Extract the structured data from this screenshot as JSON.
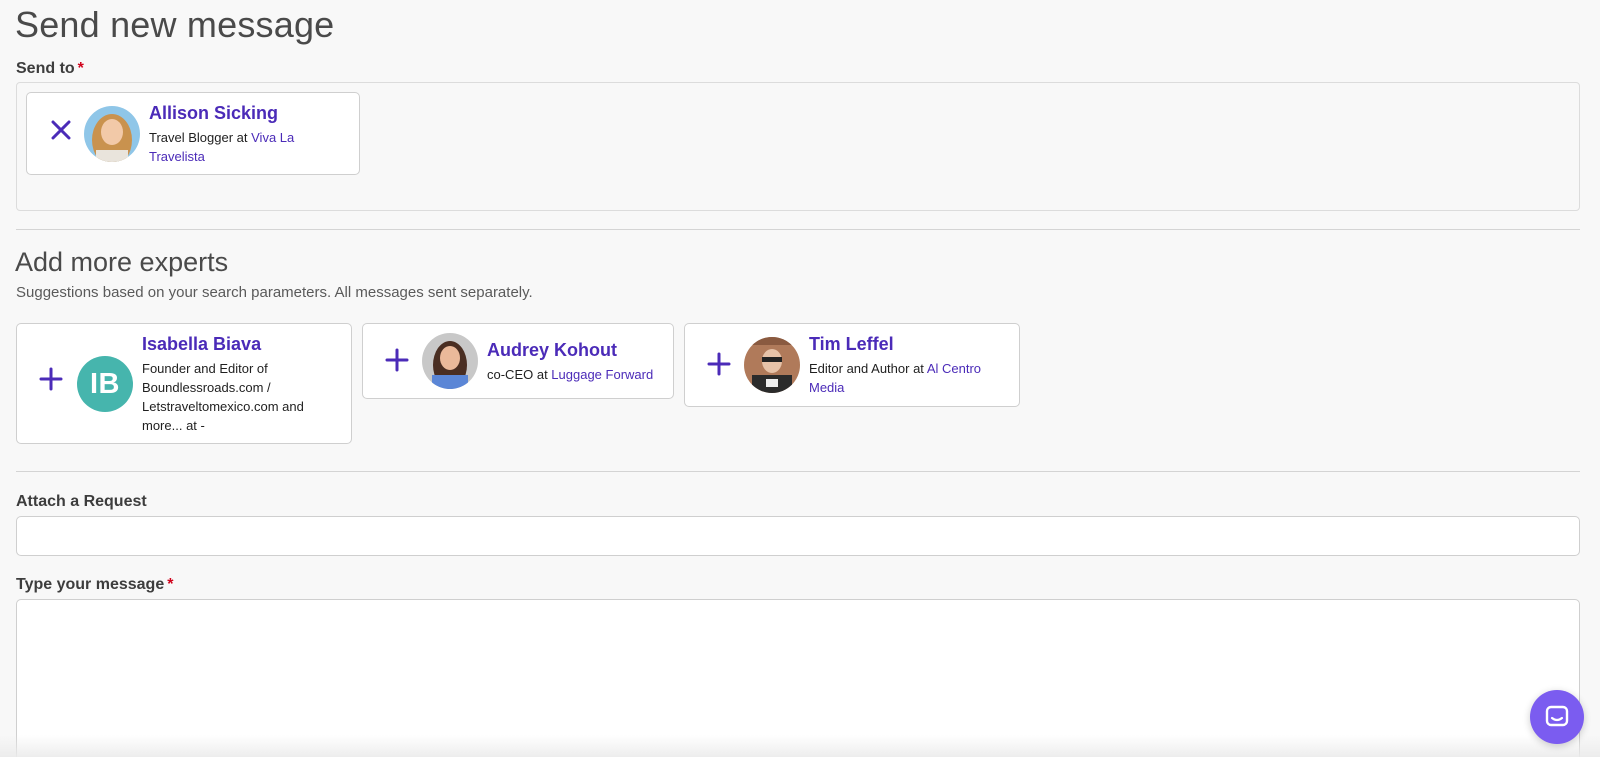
{
  "page": {
    "title": "Send new message"
  },
  "send_to": {
    "label": "Send to",
    "required_mark": "*",
    "recipients": [
      {
        "name": "Allison Sicking",
        "role": "Travel Blogger at ",
        "org": "Viva La Travelista",
        "action_icon": "close-icon"
      }
    ]
  },
  "experts": {
    "title": "Add more experts",
    "subtitle": "Suggestions based on your search parameters. All messages sent separately.",
    "items": [
      {
        "name": "Isabella Biava",
        "initials": "IB",
        "role": "Founder and Editor of Boundlessroads.com / Letstraveltomexico.com and more... at -",
        "org": "",
        "action_icon": "plus-icon"
      },
      {
        "name": "Audrey Kohout",
        "role": "co-CEO at ",
        "org": "Luggage Forward",
        "action_icon": "plus-icon"
      },
      {
        "name": "Tim Leffel",
        "role": "Editor and Author at ",
        "org": "Al Centro Media",
        "action_icon": "plus-icon"
      }
    ]
  },
  "attach_request": {
    "label": "Attach a Request",
    "value": ""
  },
  "message": {
    "label": "Type your message",
    "required_mark": "*",
    "value": ""
  },
  "chat_launcher": {
    "icon": "chat-icon"
  },
  "colors": {
    "accent": "#4b2bb8",
    "initials_bg": "#46b5ad",
    "chat_bg": "#7b5cf0",
    "required": "#d0021b"
  }
}
